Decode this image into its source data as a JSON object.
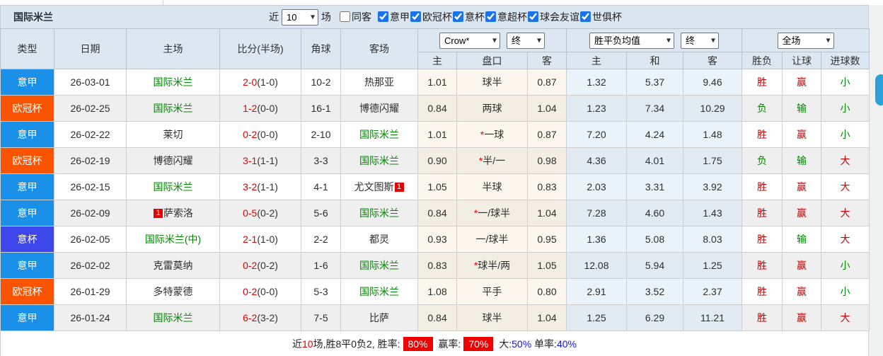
{
  "title": "国际米兰",
  "filters": {
    "near": "近",
    "count": "10",
    "games": "场",
    "checkboxes": [
      {
        "label": "同客",
        "checked": false
      },
      {
        "label": "意甲",
        "checked": true
      },
      {
        "label": "欧冠杯",
        "checked": true
      },
      {
        "label": "意杯",
        "checked": true
      },
      {
        "label": "意超杯",
        "checked": true
      },
      {
        "label": "球会友谊",
        "checked": true
      },
      {
        "label": "世俱杯",
        "checked": true
      }
    ]
  },
  "header": {
    "static_cols": [
      "类型",
      "日期",
      "主场",
      "比分(半场)",
      "角球",
      "客场"
    ],
    "odds_selects": [
      "Crow*",
      "终"
    ],
    "avg_selects": [
      "胜平负均值",
      "终"
    ],
    "scope_select": "全场",
    "odds_sub": [
      "主",
      "盘口",
      "客"
    ],
    "avg_sub": [
      "主",
      "和",
      "客"
    ],
    "result_sub": [
      "胜负",
      "让球",
      "进球数"
    ]
  },
  "league_colors": {
    "意甲": "#1a90e8",
    "欧冠杯": "#fa5400",
    "意杯": "#3d46e8"
  },
  "result_colors": {
    "胜": "#cc0000",
    "赢": "#cc0000",
    "大": "#cc0000",
    "负": "#008800",
    "输": "#008800",
    "小": "#008800"
  },
  "rows": [
    {
      "league": "意甲",
      "date": "26-03-01",
      "home": {
        "name": "国际米兰",
        "green": true
      },
      "ft": "2-0",
      "ht": "(1-0)",
      "corners": "10-2",
      "away": {
        "name": "热那亚",
        "green": false
      },
      "odds_home": "1.01",
      "handicap": "球半",
      "star": false,
      "odds_away": "0.87",
      "avg_home": "1.32",
      "avg_draw": "5.37",
      "avg_away": "9.46",
      "result": "胜",
      "handicap_result": "赢",
      "goals_result": "小"
    },
    {
      "league": "欧冠杯",
      "date": "26-02-25",
      "home": {
        "name": "国际米兰",
        "green": true
      },
      "ft": "1-2",
      "ht": "(0-0)",
      "corners": "16-1",
      "away": {
        "name": "博德闪耀",
        "green": false
      },
      "odds_home": "0.84",
      "handicap": "两球",
      "star": false,
      "odds_away": "1.04",
      "avg_home": "1.23",
      "avg_draw": "7.34",
      "avg_away": "10.29",
      "result": "负",
      "handicap_result": "输",
      "goals_result": "小"
    },
    {
      "league": "意甲",
      "date": "26-02-22",
      "home": {
        "name": "莱切",
        "green": false
      },
      "ft": "0-2",
      "ht": "(0-0)",
      "corners": "2-10",
      "away": {
        "name": "国际米兰",
        "green": true
      },
      "odds_home": "1.01",
      "handicap": "一球",
      "star": true,
      "odds_away": "0.87",
      "avg_home": "7.20",
      "avg_draw": "4.24",
      "avg_away": "1.48",
      "result": "胜",
      "handicap_result": "赢",
      "goals_result": "小"
    },
    {
      "league": "欧冠杯",
      "date": "26-02-19",
      "home": {
        "name": "博德闪耀",
        "green": false
      },
      "ft": "3-1",
      "ht": "(1-1)",
      "corners": "3-3",
      "away": {
        "name": "国际米兰",
        "green": true
      },
      "odds_home": "0.90",
      "handicap": "半/一",
      "star": true,
      "odds_away": "0.98",
      "avg_home": "4.36",
      "avg_draw": "4.01",
      "avg_away": "1.75",
      "result": "负",
      "handicap_result": "输",
      "goals_result": "大"
    },
    {
      "league": "意甲",
      "date": "26-02-15",
      "home": {
        "name": "国际米兰",
        "green": true
      },
      "ft": "3-2",
      "ht": "(1-1)",
      "corners": "4-1",
      "away": {
        "name": "尤文图斯",
        "green": false,
        "badge": "1",
        "badge_pos": "after"
      },
      "odds_home": "1.05",
      "handicap": "半球",
      "star": false,
      "odds_away": "0.83",
      "avg_home": "2.03",
      "avg_draw": "3.31",
      "avg_away": "3.92",
      "result": "胜",
      "handicap_result": "赢",
      "goals_result": "大"
    },
    {
      "league": "意甲",
      "date": "26-02-09",
      "home": {
        "name": "萨索洛",
        "green": false,
        "badge": "1",
        "badge_pos": "before"
      },
      "ft": "0-5",
      "ht": "(0-2)",
      "corners": "5-6",
      "away": {
        "name": "国际米兰",
        "green": true
      },
      "odds_home": "0.84",
      "handicap": "一/球半",
      "star": true,
      "odds_away": "1.04",
      "avg_home": "7.28",
      "avg_draw": "4.60",
      "avg_away": "1.43",
      "result": "胜",
      "handicap_result": "赢",
      "goals_result": "大"
    },
    {
      "league": "意杯",
      "date": "26-02-05",
      "home": {
        "name": "国际米兰(中)",
        "green": true
      },
      "ft": "2-1",
      "ht": "(1-0)",
      "corners": "2-2",
      "away": {
        "name": "都灵",
        "green": false
      },
      "odds_home": "0.93",
      "handicap": "一/球半",
      "star": false,
      "odds_away": "0.95",
      "avg_home": "1.36",
      "avg_draw": "5.08",
      "avg_away": "8.03",
      "result": "胜",
      "handicap_result": "输",
      "goals_result": "大"
    },
    {
      "league": "意甲",
      "date": "26-02-02",
      "home": {
        "name": "克雷莫纳",
        "green": false
      },
      "ft": "0-2",
      "ht": "(0-2)",
      "corners": "1-6",
      "away": {
        "name": "国际米兰",
        "green": true
      },
      "odds_home": "0.83",
      "handicap": "球半/两",
      "star": true,
      "odds_away": "1.05",
      "avg_home": "12.08",
      "avg_draw": "5.94",
      "avg_away": "1.25",
      "result": "胜",
      "handicap_result": "赢",
      "goals_result": "小"
    },
    {
      "league": "欧冠杯",
      "date": "26-01-29",
      "home": {
        "name": "多特蒙德",
        "green": false
      },
      "ft": "0-2",
      "ht": "(0-0)",
      "corners": "5-3",
      "away": {
        "name": "国际米兰",
        "green": true
      },
      "odds_home": "1.08",
      "handicap": "平手",
      "star": false,
      "odds_away": "0.80",
      "avg_home": "2.91",
      "avg_draw": "3.52",
      "avg_away": "2.37",
      "result": "胜",
      "handicap_result": "赢",
      "goals_result": "小"
    },
    {
      "league": "意甲",
      "date": "26-01-24",
      "home": {
        "name": "国际米兰",
        "green": true
      },
      "ft": "6-2",
      "ht": "(3-2)",
      "corners": "7-5",
      "away": {
        "name": "比萨",
        "green": false
      },
      "odds_home": "0.84",
      "handicap": "球半",
      "star": false,
      "odds_away": "1.04",
      "avg_home": "1.25",
      "avg_draw": "6.29",
      "avg_away": "11.21",
      "result": "胜",
      "handicap_result": "赢",
      "goals_result": "大"
    }
  ],
  "footer": {
    "parts": [
      {
        "text": "近",
        "style": "plain"
      },
      {
        "text": "10",
        "style": "red"
      },
      {
        "text": "场,胜8平0负2, 胜率:",
        "style": "plain"
      },
      {
        "text": "80%",
        "style": "red-badge"
      },
      {
        "text": " 赢率:",
        "style": "plain"
      },
      {
        "text": "70%",
        "style": "red-badge"
      },
      {
        "text": " 大:",
        "style": "plain"
      },
      {
        "text": "50%",
        "style": "blue"
      },
      {
        "text": " 单率:",
        "style": "plain"
      },
      {
        "text": "40%",
        "style": "blue"
      }
    ]
  }
}
